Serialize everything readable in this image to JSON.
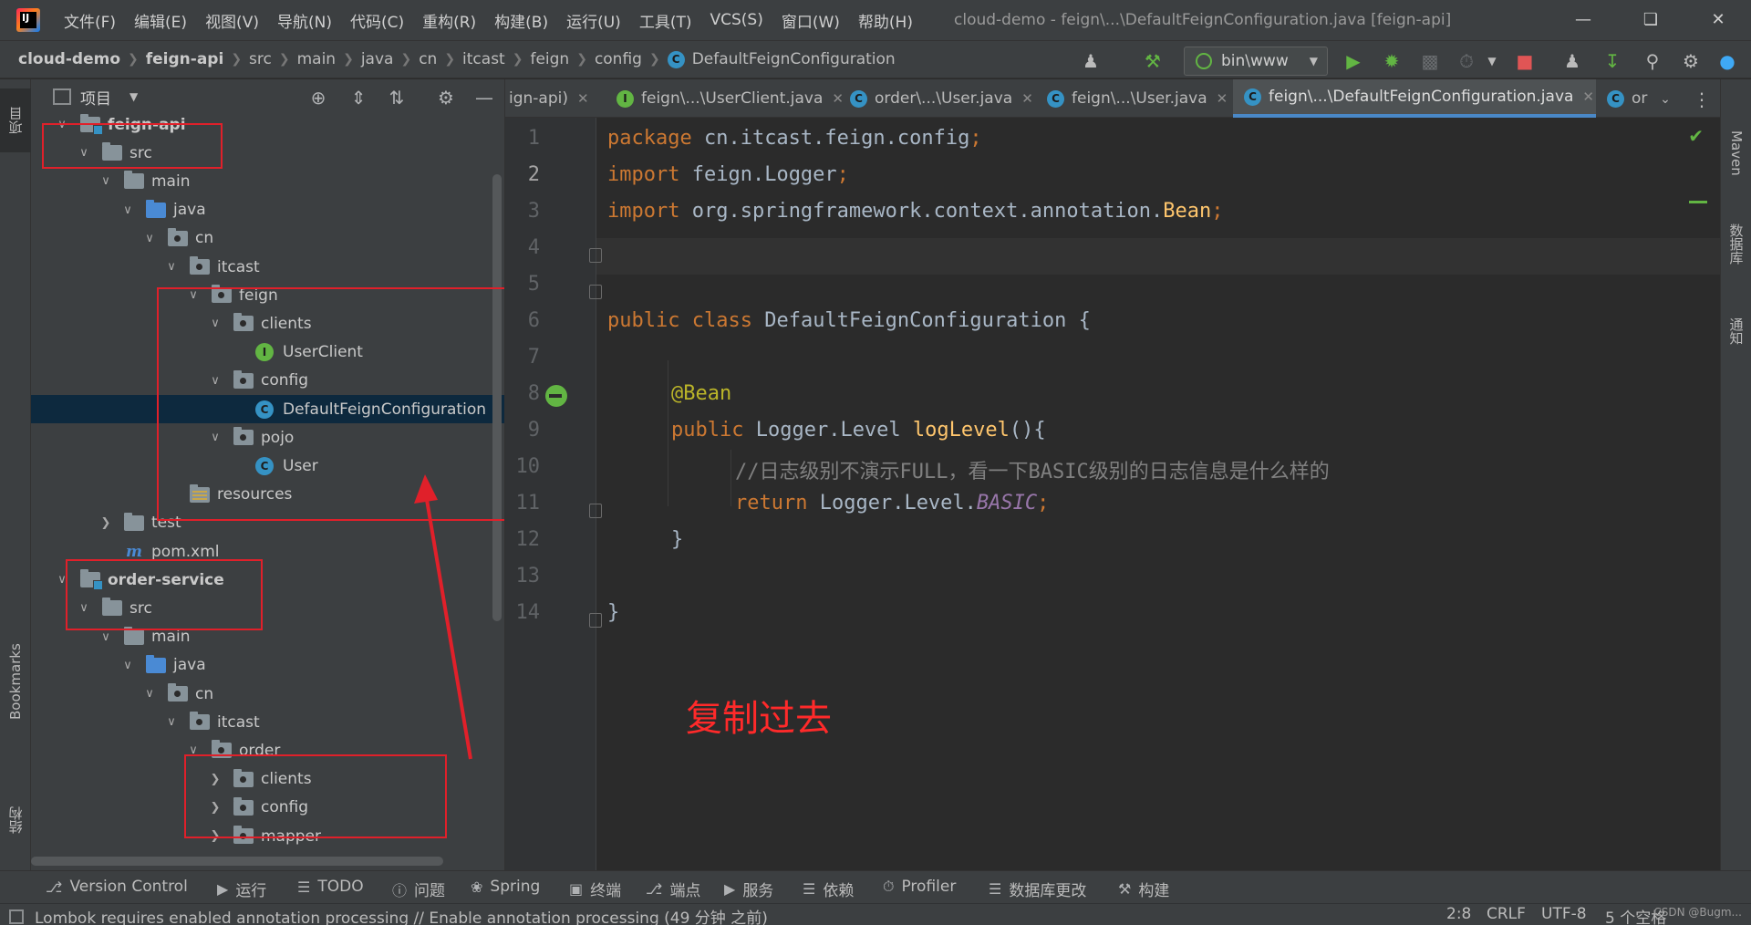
{
  "menubar": {
    "items": [
      "文件(F)",
      "编辑(E)",
      "视图(V)",
      "导航(N)",
      "代码(C)",
      "重构(R)",
      "构建(B)",
      "运行(U)",
      "工具(T)",
      "VCS(S)",
      "窗口(W)",
      "帮助(H)"
    ],
    "window_title": "cloud-demo - feign\\...\\DefaultFeignConfiguration.java [feign-api]"
  },
  "navbar": {
    "breadcrumbs": [
      "cloud-demo",
      "feign-api",
      "src",
      "main",
      "java",
      "cn",
      "itcast",
      "feign",
      "config",
      "DefaultFeignConfiguration"
    ],
    "run_config": "bin\\www"
  },
  "project_panel": {
    "title": "项目",
    "tree": [
      {
        "label": "feign-api",
        "arrow": "v",
        "icon": "module",
        "bold": true
      },
      {
        "label": "src",
        "arrow": "v",
        "icon": "folder"
      },
      {
        "label": "main",
        "arrow": "v",
        "icon": "folder"
      },
      {
        "label": "java",
        "arrow": "v",
        "icon": "src"
      },
      {
        "label": "cn",
        "arrow": "v",
        "icon": "pkg"
      },
      {
        "label": "itcast",
        "arrow": "v",
        "icon": "pkg"
      },
      {
        "label": "feign",
        "arrow": "v",
        "icon": "pkg"
      },
      {
        "label": "clients",
        "arrow": "v",
        "icon": "pkg"
      },
      {
        "label": "UserClient",
        "arrow": "",
        "icon": "interface"
      },
      {
        "label": "config",
        "arrow": "v",
        "icon": "pkg"
      },
      {
        "label": "DefaultFeignConfiguration",
        "arrow": "",
        "icon": "class",
        "selected": true
      },
      {
        "label": "pojo",
        "arrow": "v",
        "icon": "pkg"
      },
      {
        "label": "User",
        "arrow": "",
        "icon": "class"
      },
      {
        "label": "resources",
        "arrow": "",
        "icon": "res"
      },
      {
        "label": "test",
        "arrow": ">",
        "icon": "folder"
      },
      {
        "label": "pom.xml",
        "arrow": "",
        "icon": "maven"
      },
      {
        "label": "order-service",
        "arrow": "v",
        "icon": "module",
        "bold": true
      },
      {
        "label": "src",
        "arrow": "v",
        "icon": "folder"
      },
      {
        "label": "main",
        "arrow": "v",
        "icon": "folder"
      },
      {
        "label": "java",
        "arrow": "v",
        "icon": "src"
      },
      {
        "label": "cn",
        "arrow": "v",
        "icon": "pkg"
      },
      {
        "label": "itcast",
        "arrow": "v",
        "icon": "pkg"
      },
      {
        "label": "order",
        "arrow": "v",
        "icon": "pkg"
      },
      {
        "label": "clients",
        "arrow": ">",
        "icon": "pkg"
      },
      {
        "label": "config",
        "arrow": ">",
        "icon": "pkg"
      },
      {
        "label": "mapper",
        "arrow": ">",
        "icon": "pkg"
      }
    ]
  },
  "left_strip": {
    "project": "项目",
    "bookmarks": "Bookmarks",
    "structure": "结构",
    "npm": "npm"
  },
  "right_strip": {
    "maven": "Maven",
    "database": "数据库",
    "notifications": "通知"
  },
  "editor": {
    "tabs": [
      {
        "label": "ign-api)",
        "icon": ""
      },
      {
        "label": "feign\\...\\UserClient.java",
        "icon": "I"
      },
      {
        "label": "order\\...\\User.java",
        "icon": "C"
      },
      {
        "label": "feign\\...\\User.java",
        "icon": "C"
      },
      {
        "label": "feign\\...\\DefaultFeignConfiguration.java",
        "icon": "C",
        "active": true
      },
      {
        "label": "or",
        "icon": "C"
      }
    ],
    "line_numbers": [
      "1",
      "2",
      "3",
      "4",
      "5",
      "6",
      "7",
      "8",
      "9",
      "10",
      "11",
      "12",
      "13",
      "14"
    ],
    "code": {
      "l1": {
        "kw": "package",
        "rest": " cn.itcast.feign.config",
        "semi": ";"
      },
      "l2": {
        "kw": "import",
        "rest": " feign.Logger",
        "semi": ";"
      },
      "l3": {
        "kw": "import",
        "rest": " org.springframework.context.annotation.",
        "cls": "Bean",
        "semi": ";"
      },
      "l6": {
        "kw1": "public",
        "kw2": " class",
        "rest": " DefaultFeignConfiguration {"
      },
      "l8": {
        "ann": "@Bean"
      },
      "l9": {
        "kw": "public",
        "type": " Logger.Level ",
        "fn": "logLevel",
        "rest": "(){"
      },
      "l10": {
        "comment": "//日志级别不演示FULL，看一下BASIC级别的日志信息是什么样的"
      },
      "l11": {
        "kw": "return",
        "rest": " Logger.Level.",
        "const": "BASIC",
        "semi": ";"
      },
      "l12": {
        "brace": "}"
      },
      "l14": {
        "brace": "}"
      }
    },
    "annotation": "复制过去"
  },
  "bottom_tools": [
    "Version Control",
    "运行",
    "TODO",
    "问题",
    "Spring",
    "终端",
    "端点",
    "服务",
    "依赖",
    "Profiler",
    "数据库更改",
    "构建"
  ],
  "status": {
    "message": "Lombok requires enabled annotation processing // Enable annotation processing (49 分钟 之前)",
    "position": "2:8",
    "line_sep": "CRLF",
    "encoding": "UTF-8",
    "indent": "5 个空格",
    "watermark": "CSDN @Bugm..."
  },
  "colors": {
    "selection": "#0d293e",
    "annotation_red": "#e0202a",
    "keyword": "#cc7832"
  }
}
